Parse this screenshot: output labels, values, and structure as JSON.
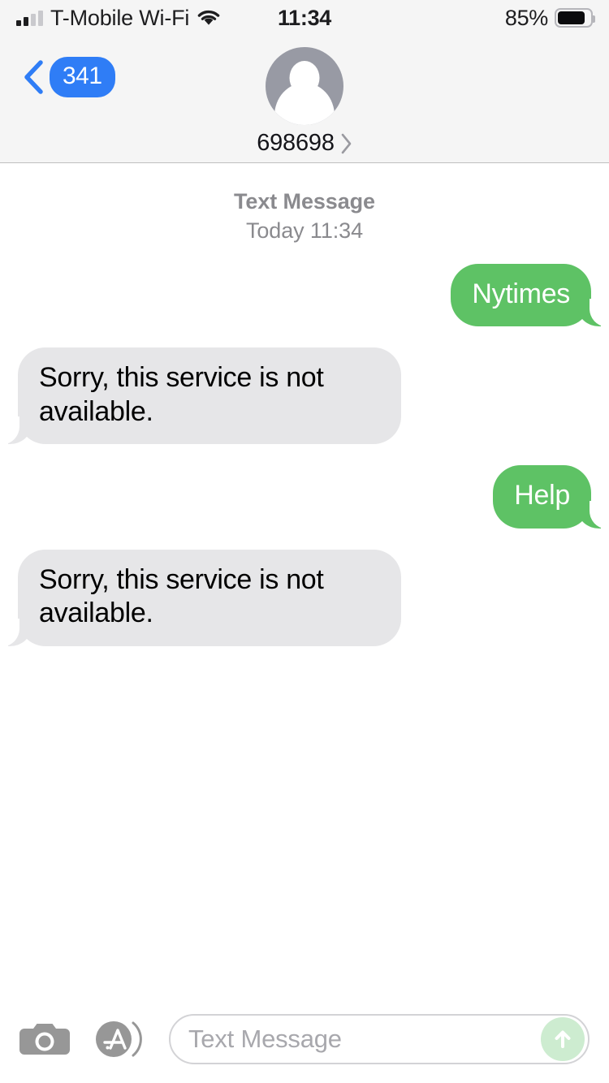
{
  "status_bar": {
    "carrier": "T-Mobile Wi-Fi",
    "time": "11:34",
    "battery_percent": "85%",
    "signal_bars_filled": 2,
    "signal_bars_total": 4,
    "wifi_icon": "wifi-icon",
    "battery_icon": "battery-icon"
  },
  "nav_bar": {
    "back_badge": "341",
    "back_icon": "chevron-left-icon",
    "contact_name": "698698",
    "contact_chevron_icon": "chevron-right-icon",
    "avatar_icon": "person-placeholder-avatar"
  },
  "conversation": {
    "header_label": "Text Message",
    "header_time": "Today 11:34",
    "messages": [
      {
        "direction": "outgoing",
        "text": "Nytimes"
      },
      {
        "direction": "incoming",
        "text": "Sorry, this service is not available."
      },
      {
        "direction": "outgoing",
        "text": "Help"
      },
      {
        "direction": "incoming",
        "text": "Sorry, this service is not available."
      }
    ]
  },
  "toolbar": {
    "camera_icon": "camera-icon",
    "appstore_icon": "app-store-icon",
    "input_placeholder": "Text Message",
    "input_value": "",
    "send_icon": "arrow-up-icon"
  },
  "colors": {
    "outgoing_bubble": "#5ec265",
    "incoming_bubble": "#e6e6e8",
    "accent_blue": "#2f7df6",
    "header_bg": "#F5F5F5",
    "send_button_bg": "#cdecd0"
  }
}
